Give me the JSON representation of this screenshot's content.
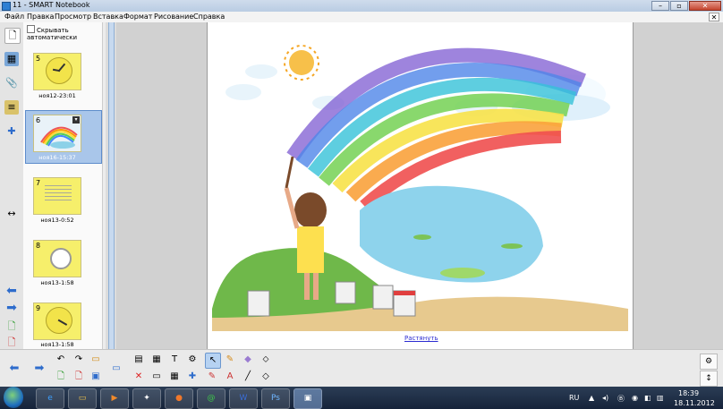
{
  "window": {
    "title": "11 - SMART Notebook"
  },
  "menu": [
    "Файл",
    "Правка",
    "Просмотр",
    "Вставка",
    "Формат",
    "Рисование",
    "Справка"
  ],
  "sorter": {
    "autohide_label": "Скрывать автоматически",
    "pages": [
      {
        "num": "5",
        "label": "ноя12-23:01"
      },
      {
        "num": "6",
        "label": "ноя16-15:37"
      },
      {
        "num": "7",
        "label": "ноя13-0:52"
      },
      {
        "num": "8",
        "label": "ноя13-1:58"
      },
      {
        "num": "9",
        "label": "ноя13-1:58"
      }
    ]
  },
  "canvas": {
    "link_text": "Растянуть"
  },
  "tray": {
    "language": "RU",
    "time": "18:39",
    "date": "18.11.2012"
  },
  "colors": {
    "titlebar": "#b9cce3",
    "accent": "#5d8ccb",
    "taskbar": "#1e2d45",
    "thumb": "#f6ef6b"
  }
}
